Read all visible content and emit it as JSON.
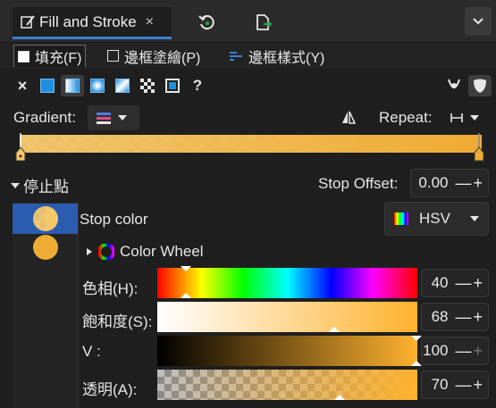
{
  "tabs": {
    "active_label": "Fill and Stroke",
    "close_glyph": "×"
  },
  "subtabs": {
    "fill": "填充(F)",
    "stroke_paint": "邊框塗繪(P)",
    "stroke_style": "邊框樣式(Y)"
  },
  "paint_types": {
    "unset_glyph": "×",
    "unset_paint": "?"
  },
  "gradient": {
    "label": "Gradient:",
    "repeat_label": "Repeat:",
    "repeat_glyph": "⟝⟞",
    "start_color": "#f5c768",
    "end_color": "#efac34"
  },
  "stops": {
    "header": "停止點",
    "stop_offset_label": "Stop Offset:",
    "stop_offset_value": "0.00",
    "stop_color_label": "Stop color",
    "color_model": "HSV",
    "color_wheel_label": "Color Wheel"
  },
  "sliders": [
    {
      "label": "色相(H):",
      "value": "40",
      "fraction": 0.111
    },
    {
      "label": "飽和度(S):",
      "value": "68",
      "fraction": 0.68
    },
    {
      "label": "V :",
      "value": "100",
      "fraction": 1.0
    },
    {
      "label": "透明(A):",
      "value": "70",
      "fraction": 0.7
    }
  ],
  "colors": {
    "accent": "#3c7fd3",
    "selected_stop": "#2a5db0",
    "stop_color": "#f5c768",
    "stop_color_2": "#efac34"
  }
}
